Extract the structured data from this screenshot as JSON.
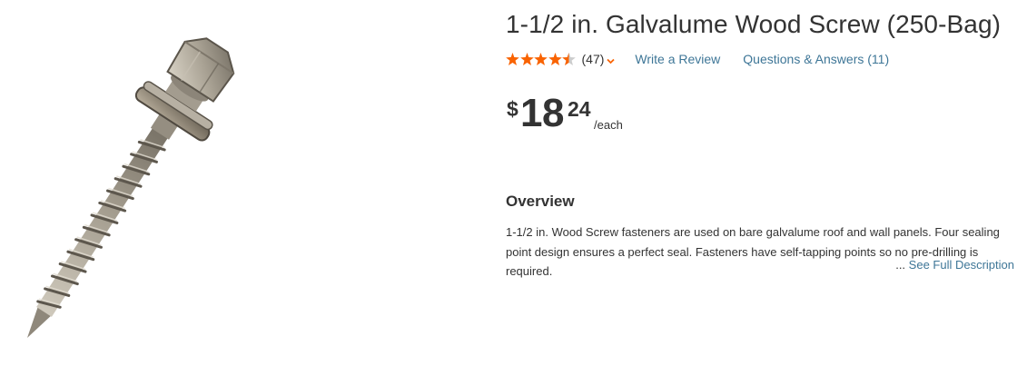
{
  "product": {
    "title": "1-1/2 in. Galvalume Wood Screw (250-Bag)",
    "image_alt": "galvalume wood screw"
  },
  "rating": {
    "stars": 4.5,
    "max_stars": 5,
    "count_label": "(47)",
    "star_color": "#f96302"
  },
  "links": {
    "write_review": "Write a Review",
    "questions_answers": "Questions & Answers (11)",
    "link_color": "#3e7697"
  },
  "price": {
    "currency": "$",
    "whole": "18",
    "cents": "24",
    "unit": "/each"
  },
  "overview": {
    "heading": "Overview",
    "description": "1-1/2 in. Wood Screw fasteners are used on bare galvalume roof and wall panels. Four sealing point design ensures a perfect seal. Fasteners have self-tapping points so no pre-drilling is required.",
    "ellipsis": "...",
    "see_full": "See Full Description"
  },
  "icons": {
    "star": "star-icon",
    "half_star": "half-star-icon",
    "chevron": "chevron-down-icon"
  }
}
